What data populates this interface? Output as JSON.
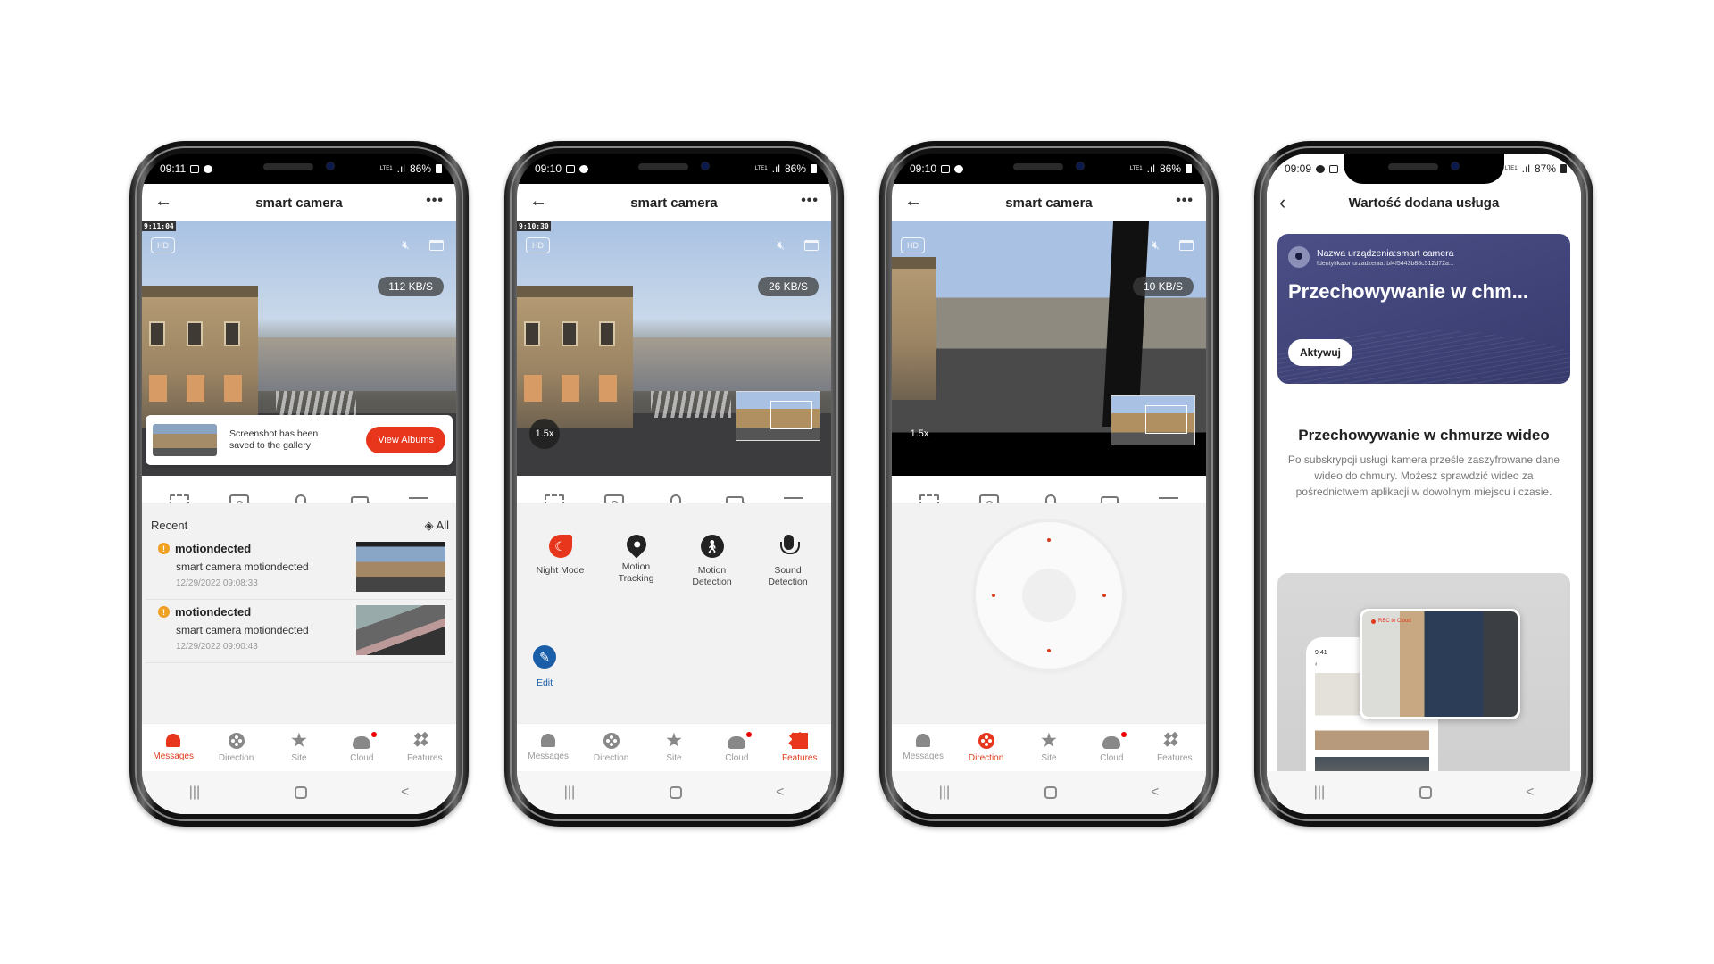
{
  "phones": [
    {
      "status": {
        "time": "09:11",
        "battery": "86%",
        "network": "VoLTE LTE1"
      },
      "title": "smart camera",
      "video": {
        "timestamp": "9:11:04",
        "quality": "HD",
        "speed": "112 KB/S"
      },
      "toast": {
        "message": "Screenshot has been saved to the gallery",
        "button": "View Albums"
      },
      "recent": {
        "heading": "Recent",
        "all_label": "All",
        "events": [
          {
            "title": "motiondected",
            "description": "smart camera motiondected",
            "time": "12/29/2022 09:08:33"
          },
          {
            "title": "motiondected",
            "description": "smart camera motiondected",
            "time": "12/29/2022 09:00:43"
          }
        ]
      },
      "active_tab": "Messages"
    },
    {
      "status": {
        "time": "09:10",
        "battery": "86%",
        "network": "VoLTE LTE1"
      },
      "title": "smart camera",
      "video": {
        "timestamp": "9:10:30",
        "quality": "HD",
        "speed": "26 KB/S",
        "zoom": "1.5x"
      },
      "features": [
        {
          "label": "Night Mode",
          "icon": "night-mode-icon"
        },
        {
          "label": "Motion Tracking",
          "icon": "location-pin-icon"
        },
        {
          "label": "Motion Detection",
          "icon": "walking-person-icon"
        },
        {
          "label": "Sound Detection",
          "icon": "microphone-icon"
        }
      ],
      "edit_label": "Edit",
      "active_tab": "Features"
    },
    {
      "status": {
        "time": "09:10",
        "battery": "86%",
        "network": "VoLTE LTE1"
      },
      "title": "smart camera",
      "video": {
        "quality": "HD",
        "speed": "10 KB/S",
        "zoom": "1.5x"
      },
      "active_tab": "Direction"
    },
    {
      "status": {
        "time": "09:09",
        "battery": "87%",
        "network": "VoLTE LTE1"
      },
      "title": "Wartość dodana usługa",
      "card": {
        "device_name": "Nazwa urządzenia:smart camera",
        "device_id": "Identyfikator urzadzenia: bf4f5443b88c512d72a...",
        "heading": "Przechowywanie w chm...",
        "button": "Aktywuj"
      },
      "section": {
        "title": "Przechowywanie w chmurze wideo",
        "body": "Po subskrypcji usługi kamera prześle zaszyfrowane dane wideo do chmury. Możesz sprawdzić wideo za pośrednictwem aplikacji w dowolnym miejscu i czasie."
      },
      "promo": {
        "mini_time": "9:41",
        "rec_label": "REC to Cloud"
      }
    }
  ],
  "tabs": [
    "Messages",
    "Direction",
    "Site",
    "Cloud",
    "Features"
  ],
  "colors": {
    "accent": "#e8361d",
    "warning": "#f0a022",
    "edit_blue": "#1a5ea8",
    "card_bg": "#3f4378"
  }
}
